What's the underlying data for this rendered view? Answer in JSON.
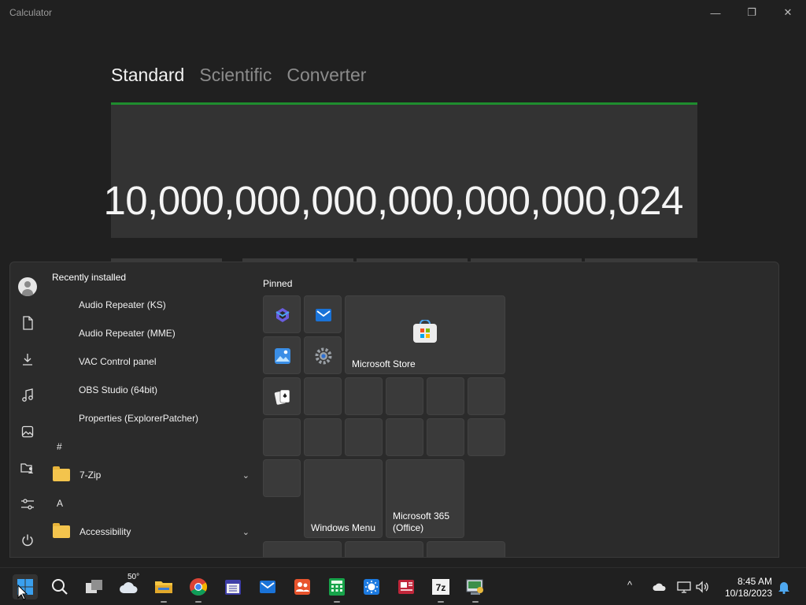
{
  "window": {
    "title": "Calculator",
    "minimize_icon": "—",
    "maximize_icon": "❐",
    "close_icon": "✕"
  },
  "calculator": {
    "tabs": [
      "Standard",
      "Scientific",
      "Converter"
    ],
    "active_tab": "Standard",
    "display_value": "10,000,000,000,000,000,000,024",
    "accent_color": "#1f8d2e"
  },
  "start_menu": {
    "rail_icons": [
      "account-icon",
      "documents-icon",
      "downloads-icon",
      "music-icon",
      "pictures-icon",
      "user-folder-icon",
      "settings-icon",
      "power-icon"
    ],
    "recently_installed_header": "Recently installed",
    "recent_items": [
      "Audio Repeater (KS)",
      "Audio Repeater (MME)",
      "VAC Control panel",
      "OBS Studio (64bit)",
      "Properties (ExplorerPatcher)"
    ],
    "letter_hash": "#",
    "letter_a": "A",
    "folders": [
      {
        "label": "7-Zip",
        "chevron": "⌄"
      },
      {
        "label": "Accessibility",
        "chevron": "⌄"
      }
    ],
    "pinned_header": "Pinned",
    "pinned_tiles": {
      "microsoft_store": "Microsoft Store",
      "windows_menu": "Windows Menu",
      "microsoft_365": "Microsoft 365 (Office)"
    }
  },
  "taskbar": {
    "weather_temp": "50°",
    "clock_time": "8:45 AM",
    "clock_date": "10/18/2023",
    "tray_chevron": "^"
  }
}
